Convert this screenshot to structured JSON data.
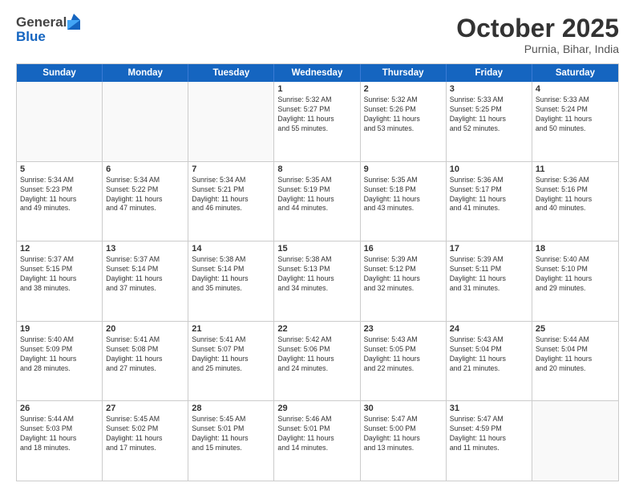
{
  "header": {
    "logo_general": "General",
    "logo_blue": "Blue",
    "month": "October 2025",
    "location": "Purnia, Bihar, India"
  },
  "days_of_week": [
    "Sunday",
    "Monday",
    "Tuesday",
    "Wednesday",
    "Thursday",
    "Friday",
    "Saturday"
  ],
  "weeks": [
    [
      {
        "day": "",
        "text": ""
      },
      {
        "day": "",
        "text": ""
      },
      {
        "day": "",
        "text": ""
      },
      {
        "day": "1",
        "text": "Sunrise: 5:32 AM\nSunset: 5:27 PM\nDaylight: 11 hours\nand 55 minutes."
      },
      {
        "day": "2",
        "text": "Sunrise: 5:32 AM\nSunset: 5:26 PM\nDaylight: 11 hours\nand 53 minutes."
      },
      {
        "day": "3",
        "text": "Sunrise: 5:33 AM\nSunset: 5:25 PM\nDaylight: 11 hours\nand 52 minutes."
      },
      {
        "day": "4",
        "text": "Sunrise: 5:33 AM\nSunset: 5:24 PM\nDaylight: 11 hours\nand 50 minutes."
      }
    ],
    [
      {
        "day": "5",
        "text": "Sunrise: 5:34 AM\nSunset: 5:23 PM\nDaylight: 11 hours\nand 49 minutes."
      },
      {
        "day": "6",
        "text": "Sunrise: 5:34 AM\nSunset: 5:22 PM\nDaylight: 11 hours\nand 47 minutes."
      },
      {
        "day": "7",
        "text": "Sunrise: 5:34 AM\nSunset: 5:21 PM\nDaylight: 11 hours\nand 46 minutes."
      },
      {
        "day": "8",
        "text": "Sunrise: 5:35 AM\nSunset: 5:19 PM\nDaylight: 11 hours\nand 44 minutes."
      },
      {
        "day": "9",
        "text": "Sunrise: 5:35 AM\nSunset: 5:18 PM\nDaylight: 11 hours\nand 43 minutes."
      },
      {
        "day": "10",
        "text": "Sunrise: 5:36 AM\nSunset: 5:17 PM\nDaylight: 11 hours\nand 41 minutes."
      },
      {
        "day": "11",
        "text": "Sunrise: 5:36 AM\nSunset: 5:16 PM\nDaylight: 11 hours\nand 40 minutes."
      }
    ],
    [
      {
        "day": "12",
        "text": "Sunrise: 5:37 AM\nSunset: 5:15 PM\nDaylight: 11 hours\nand 38 minutes."
      },
      {
        "day": "13",
        "text": "Sunrise: 5:37 AM\nSunset: 5:14 PM\nDaylight: 11 hours\nand 37 minutes."
      },
      {
        "day": "14",
        "text": "Sunrise: 5:38 AM\nSunset: 5:14 PM\nDaylight: 11 hours\nand 35 minutes."
      },
      {
        "day": "15",
        "text": "Sunrise: 5:38 AM\nSunset: 5:13 PM\nDaylight: 11 hours\nand 34 minutes."
      },
      {
        "day": "16",
        "text": "Sunrise: 5:39 AM\nSunset: 5:12 PM\nDaylight: 11 hours\nand 32 minutes."
      },
      {
        "day": "17",
        "text": "Sunrise: 5:39 AM\nSunset: 5:11 PM\nDaylight: 11 hours\nand 31 minutes."
      },
      {
        "day": "18",
        "text": "Sunrise: 5:40 AM\nSunset: 5:10 PM\nDaylight: 11 hours\nand 29 minutes."
      }
    ],
    [
      {
        "day": "19",
        "text": "Sunrise: 5:40 AM\nSunset: 5:09 PM\nDaylight: 11 hours\nand 28 minutes."
      },
      {
        "day": "20",
        "text": "Sunrise: 5:41 AM\nSunset: 5:08 PM\nDaylight: 11 hours\nand 27 minutes."
      },
      {
        "day": "21",
        "text": "Sunrise: 5:41 AM\nSunset: 5:07 PM\nDaylight: 11 hours\nand 25 minutes."
      },
      {
        "day": "22",
        "text": "Sunrise: 5:42 AM\nSunset: 5:06 PM\nDaylight: 11 hours\nand 24 minutes."
      },
      {
        "day": "23",
        "text": "Sunrise: 5:43 AM\nSunset: 5:05 PM\nDaylight: 11 hours\nand 22 minutes."
      },
      {
        "day": "24",
        "text": "Sunrise: 5:43 AM\nSunset: 5:04 PM\nDaylight: 11 hours\nand 21 minutes."
      },
      {
        "day": "25",
        "text": "Sunrise: 5:44 AM\nSunset: 5:04 PM\nDaylight: 11 hours\nand 20 minutes."
      }
    ],
    [
      {
        "day": "26",
        "text": "Sunrise: 5:44 AM\nSunset: 5:03 PM\nDaylight: 11 hours\nand 18 minutes."
      },
      {
        "day": "27",
        "text": "Sunrise: 5:45 AM\nSunset: 5:02 PM\nDaylight: 11 hours\nand 17 minutes."
      },
      {
        "day": "28",
        "text": "Sunrise: 5:45 AM\nSunset: 5:01 PM\nDaylight: 11 hours\nand 15 minutes."
      },
      {
        "day": "29",
        "text": "Sunrise: 5:46 AM\nSunset: 5:01 PM\nDaylight: 11 hours\nand 14 minutes."
      },
      {
        "day": "30",
        "text": "Sunrise: 5:47 AM\nSunset: 5:00 PM\nDaylight: 11 hours\nand 13 minutes."
      },
      {
        "day": "31",
        "text": "Sunrise: 5:47 AM\nSunset: 4:59 PM\nDaylight: 11 hours\nand 11 minutes."
      },
      {
        "day": "",
        "text": ""
      }
    ]
  ]
}
